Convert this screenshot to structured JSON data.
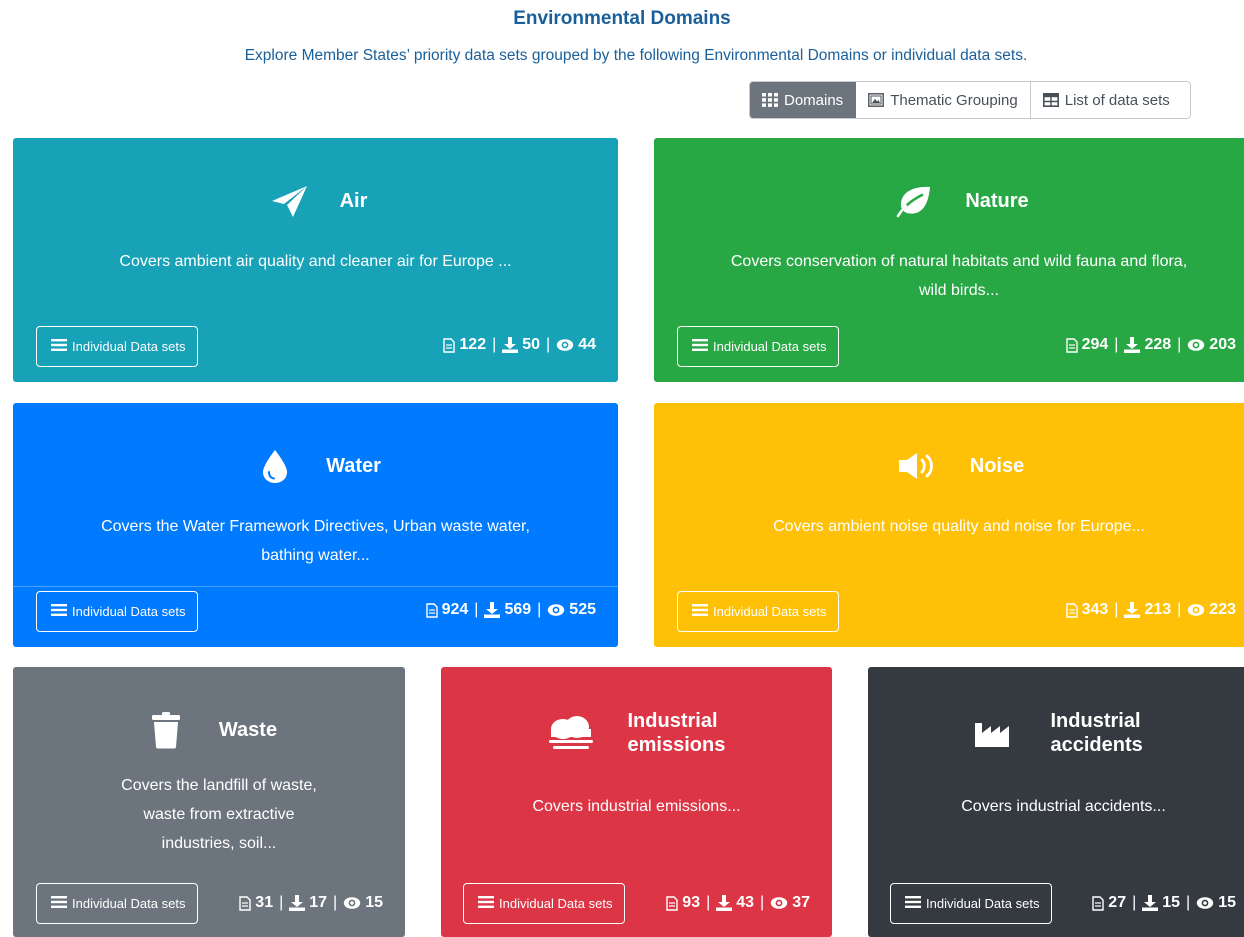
{
  "header": {
    "title": "Environmental Domains",
    "subtitle": "Explore Member States’ priority data sets grouped by the following Environmental Domains or individual data sets."
  },
  "view_toggle": {
    "tabs": [
      {
        "label": "Domains",
        "icon": "grid-icon",
        "active": true
      },
      {
        "label": "Thematic Grouping",
        "icon": "image-frame-icon",
        "active": false
      },
      {
        "label": "List of data sets",
        "icon": "table-icon",
        "active": false
      }
    ]
  },
  "colors": {
    "air": "#17a2b8",
    "nature": "#28a745",
    "water": "#007bff",
    "noise": "#ffc107",
    "waste": "#6c757d",
    "industrial_emissions": "#dc3545",
    "industrial_accidents": "#343a40",
    "title_blue": "#1a5f9a"
  },
  "domains": [
    {
      "id": "air",
      "title": "Air",
      "icon": "paper-plane-icon",
      "description": "Covers ambient air quality and cleaner air for Europe ...",
      "button_label": "Individual Data sets",
      "datasets": "122",
      "downloads": "50",
      "views": "44"
    },
    {
      "id": "nature",
      "title": "Nature",
      "icon": "leaf-icon",
      "description": "Covers conservation of natural habitats and wild fauna and flora, wild birds...",
      "button_label": "Individual Data sets",
      "datasets": "294",
      "downloads": "228",
      "views": "203"
    },
    {
      "id": "water",
      "title": "Water",
      "icon": "water-drop-icon",
      "description": "Covers the Water Framework Directives, Urban waste water, bathing water...",
      "button_label": "Individual Data sets",
      "datasets": "924",
      "downloads": "569",
      "views": "525"
    },
    {
      "id": "noise",
      "title": "Noise",
      "icon": "volume-icon",
      "description": "Covers ambient noise quality and noise for Europe...",
      "button_label": "Individual Data sets",
      "datasets": "343",
      "downloads": "213",
      "views": "223"
    },
    {
      "id": "waste",
      "title": "Waste",
      "icon": "trash-icon",
      "description": "Covers the landfill of waste, waste from extractive industries, soil...",
      "button_label": "Individual Data sets",
      "datasets": "31",
      "downloads": "17",
      "views": "15"
    },
    {
      "id": "industrial_emissions",
      "title": "Industrial emissions",
      "icon": "smog-icon",
      "description": "Covers industrial emissions...",
      "button_label": "Individual Data sets",
      "datasets": "93",
      "downloads": "43",
      "views": "37"
    },
    {
      "id": "industrial_accidents",
      "title": "Industrial accidents",
      "icon": "industry-icon",
      "description": "Covers industrial accidents...",
      "button_label": "Individual Data sets",
      "datasets": "27",
      "downloads": "15",
      "views": "15"
    }
  ]
}
